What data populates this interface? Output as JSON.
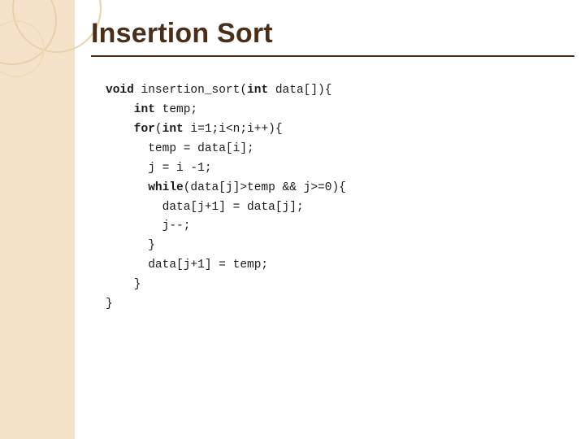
{
  "slide": {
    "title": "Insertion Sort",
    "code": {
      "l1a": "void",
      "l1b": " insertion_sort(",
      "l1c": "int",
      "l1d": " data[]){",
      "l2a": "    int",
      "l2b": " temp;",
      "l3a": "    for",
      "l3b": "(",
      "l3c": "int",
      "l3d": " i=1;i<n;i++){",
      "l4": "      temp = data[i];",
      "l5": "      j = i -1;",
      "l6a": "      while",
      "l6b": "(data[j]>temp && j>=0){",
      "l7": "        data[j+1] = data[j];",
      "l8": "        j--;",
      "l9": "      }",
      "l10": "      data[j+1] = temp;",
      "l11": "    }",
      "l12": "}"
    }
  }
}
